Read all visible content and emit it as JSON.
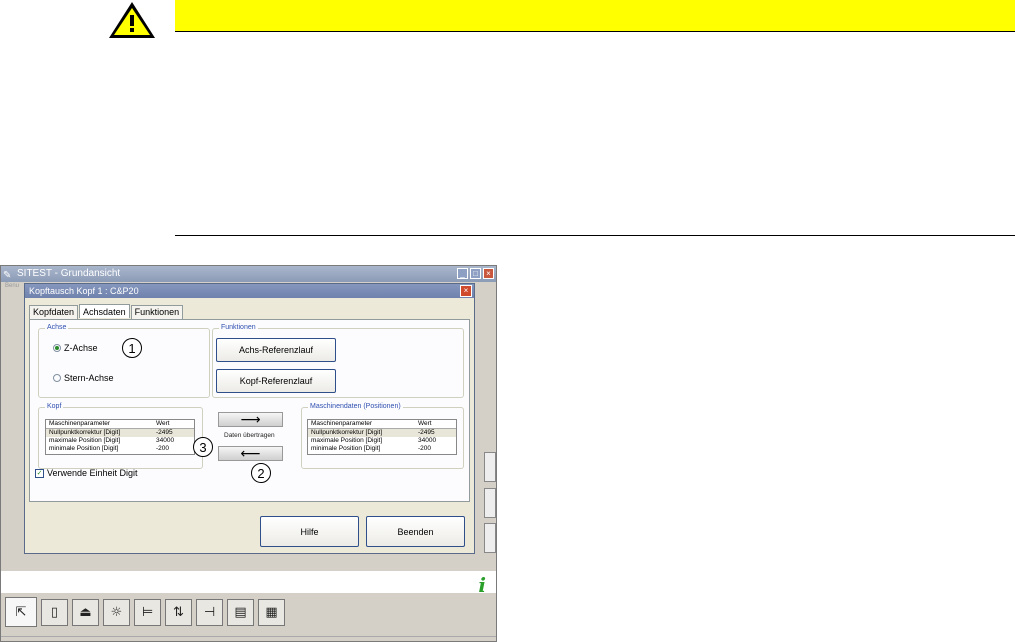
{
  "warning": {
    "icon": "warning-triangle-icon",
    "bar_color": "#ffff00"
  },
  "app": {
    "title": "SITEST - Grundansicht",
    "menu_text": "Benu",
    "window_buttons": [
      "_",
      "□",
      "×"
    ]
  },
  "dialog": {
    "title": "Kopftausch Kopf 1 : C&P20",
    "close": "×",
    "tabs": [
      "Kopfdaten",
      "Achsdaten",
      "Funktionen"
    ],
    "achse": {
      "label": "Achse",
      "options": [
        "Z-Achse",
        "Stern-Achse"
      ],
      "selected": "Z-Achse"
    },
    "funktionen": {
      "label": "Funktionen",
      "buttons": [
        "Achs-Referenzlauf",
        "Kopf-Referenzlauf"
      ]
    },
    "kopf": {
      "label": "Kopf",
      "headers": [
        "Maschinenparameter",
        "Wert"
      ],
      "rows": [
        [
          "Nullpunktkorrektur [Digit]",
          "-2495"
        ],
        [
          "maximale Position [Digit]",
          "34000"
        ],
        [
          "minimale Position [Digit]",
          "-200"
        ]
      ]
    },
    "maschinendaten": {
      "label": "Maschinendaten (Positionen)",
      "headers": [
        "Maschinenparameter",
        "Wert"
      ],
      "rows": [
        [
          "Nullpunktkorrektur [Digit]",
          "-2495"
        ],
        [
          "maximale Position [Digit]",
          "34000"
        ],
        [
          "minimale Position [Digit]",
          "-200"
        ]
      ]
    },
    "transfer": {
      "right_arrow": "⟶",
      "left_arrow": "⟵",
      "label": "Daten übertragen"
    },
    "checkbox": {
      "label": "Verwende Einheit Digit",
      "checked": true,
      "mark": "✓"
    },
    "buttons": {
      "help": "Hilfe",
      "exit": "Beenden"
    }
  },
  "callouts": [
    "1",
    "2",
    "3"
  ],
  "info_icon": {
    "name": "info-icon",
    "glyph": "i",
    "color": "#2aa02a"
  },
  "toolbar": {
    "icons": [
      {
        "name": "pointer-icon",
        "glyph": "⇱"
      },
      {
        "name": "device-icon",
        "glyph": "▯"
      },
      {
        "name": "press-icon",
        "glyph": "⏏"
      },
      {
        "name": "sun-icon",
        "glyph": "☼"
      },
      {
        "name": "conveyor-icon",
        "glyph": "⊨"
      },
      {
        "name": "lift-icon",
        "glyph": "⇅"
      },
      {
        "name": "axis-icon",
        "glyph": "⊣"
      },
      {
        "name": "grid-icon",
        "glyph": "▤"
      },
      {
        "name": "matrix-icon",
        "glyph": "▦"
      }
    ]
  }
}
